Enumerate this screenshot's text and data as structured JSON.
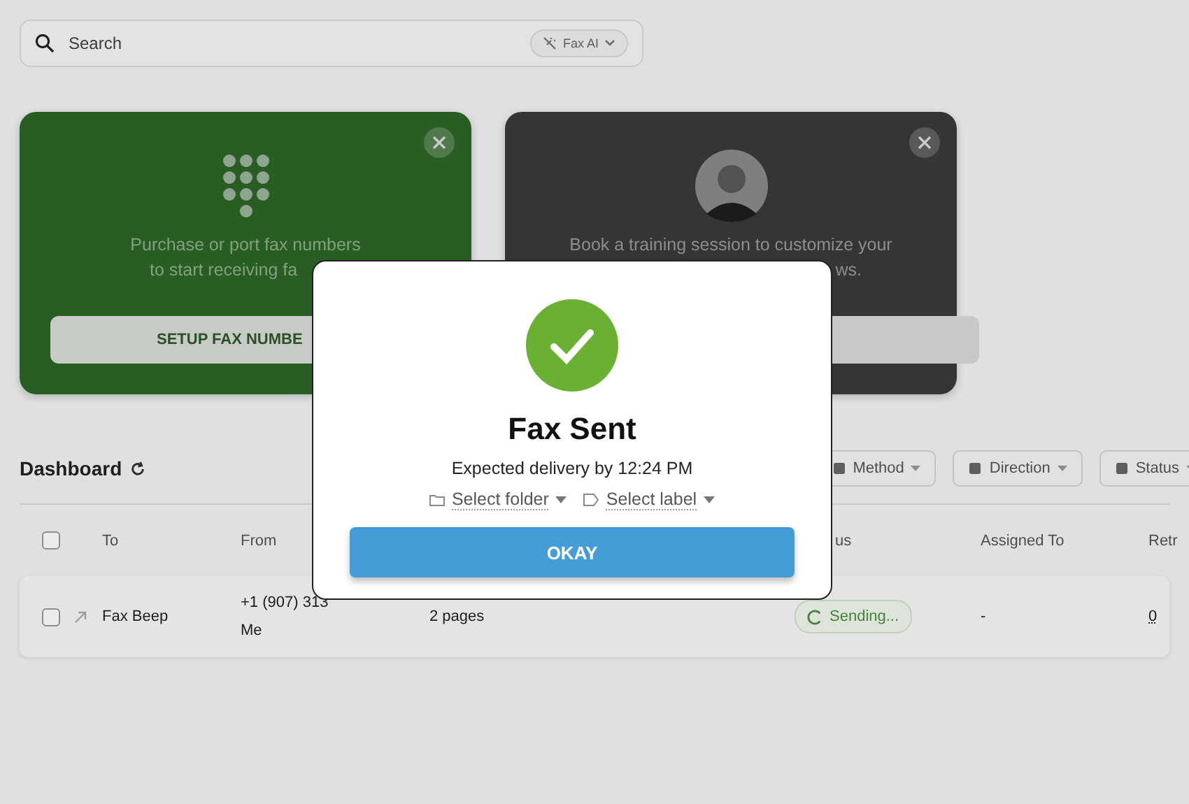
{
  "search": {
    "placeholder": "Search"
  },
  "ai_button": {
    "label": "Fax AI"
  },
  "cards": [
    {
      "kind": "numbers",
      "lines": [
        "Purchase or port fax numbers",
        "to start receiving fa"
      ],
      "button": "SETUP FAX NUMBE"
    },
    {
      "kind": "training",
      "lines": [
        "Book a training session to customize your",
        "ws."
      ]
    }
  ],
  "dashboard": {
    "title": "Dashboard",
    "filters": [
      "Method",
      "Direction",
      "Status"
    ]
  },
  "table": {
    "all_selected": false,
    "columns": [
      "To",
      "From",
      "us",
      "Assigned To",
      "Retr"
    ],
    "rows": [
      {
        "checked": false,
        "to": "Fax Beep",
        "from": "+1 (907) 313",
        "from_user": "Me",
        "pages": "2 pages",
        "status": "Sending...",
        "assigned_to": "-",
        "retries": "0"
      }
    ]
  },
  "dialog": {
    "title": "Fax Sent",
    "subtitle": "Expected delivery by 12:24 PM",
    "folder": "Select folder",
    "label": "Select label",
    "button": "OKAY"
  }
}
